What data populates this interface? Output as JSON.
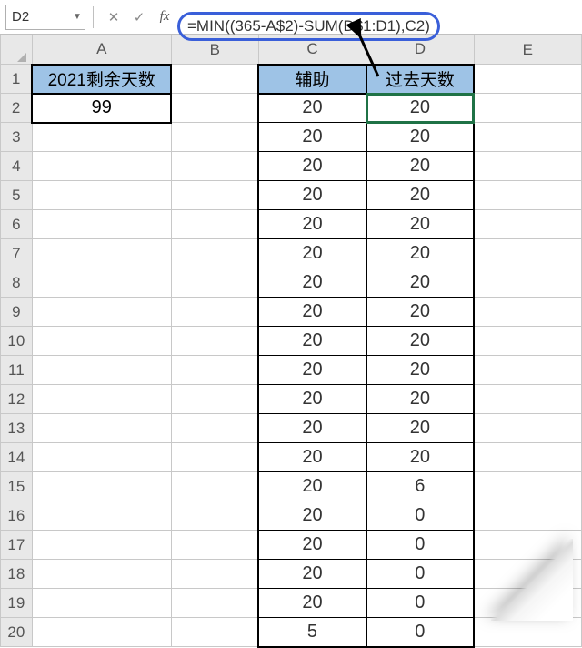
{
  "nameBox": {
    "value": "D2"
  },
  "formulaBar": {
    "formula": "=MIN((365-A$2)-SUM(D$1:D1),C2)"
  },
  "columns": [
    "A",
    "B",
    "C",
    "D",
    "E"
  ],
  "headers": {
    "A1": "2021剩余天数",
    "C1": "辅助",
    "D1": "过去天数"
  },
  "A2": "99",
  "rows": [
    {
      "r": 1
    },
    {
      "r": 2,
      "C": "20",
      "D": "20"
    },
    {
      "r": 3,
      "C": "20",
      "D": "20"
    },
    {
      "r": 4,
      "C": "20",
      "D": "20"
    },
    {
      "r": 5,
      "C": "20",
      "D": "20"
    },
    {
      "r": 6,
      "C": "20",
      "D": "20"
    },
    {
      "r": 7,
      "C": "20",
      "D": "20"
    },
    {
      "r": 8,
      "C": "20",
      "D": "20"
    },
    {
      "r": 9,
      "C": "20",
      "D": "20"
    },
    {
      "r": 10,
      "C": "20",
      "D": "20"
    },
    {
      "r": 11,
      "C": "20",
      "D": "20"
    },
    {
      "r": 12,
      "C": "20",
      "D": "20"
    },
    {
      "r": 13,
      "C": "20",
      "D": "20"
    },
    {
      "r": 14,
      "C": "20",
      "D": "20"
    },
    {
      "r": 15,
      "C": "20",
      "D": "6"
    },
    {
      "r": 16,
      "C": "20",
      "D": "0"
    },
    {
      "r": 17,
      "C": "20",
      "D": "0"
    },
    {
      "r": 18,
      "C": "20",
      "D": "0"
    },
    {
      "r": 19,
      "C": "20",
      "D": "0"
    },
    {
      "r": 20,
      "C": "5",
      "D": "0"
    }
  ]
}
